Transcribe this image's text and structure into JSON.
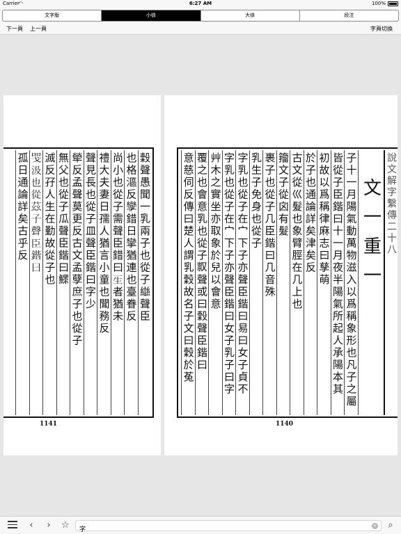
{
  "status": {
    "carrier": "Carrier",
    "wifi_icon": "wifi-icon",
    "time": "6:27 AM",
    "battery": "100%"
  },
  "segments": [
    {
      "label": "文字版",
      "active": false
    },
    {
      "label": "小徐",
      "active": true
    },
    {
      "label": "大徐",
      "active": false
    },
    {
      "label": "段注",
      "active": false
    }
  ],
  "nav": {
    "prev": "下一頁",
    "up": "上一頁",
    "switch": "字頁切換"
  },
  "pages": {
    "left": {
      "number": "1141",
      "columns": [
        "穀聲愚聞一乳兩子也從子䜌聲臣",
        "也格漚反孿錯日攣猶連也臺眷反",
        "尚小也從子需聲臣錯曰𤯔者猶未",
        "禮大夫妻日孺人猶言小童也聞務反",
        "聲見長也從子皿聲臣鍇曰字少",
        "犖反孟聲莫更反古文孟孽庶子也從子",
        "無父也從子瓜聲臣鍇曰鰥",
        "滅反孖人生在勤故從子也",
        "𢦸汲也從茲子聲臣鍇曰",
        "孤日通論詳矣古乎反"
      ]
    },
    "right": {
      "number": "1140",
      "columns": [
        "說文解字繫傳二十八",
        "文一重一",
        "子十一月陽氣動萬物滋入以爲稱象形也凡子之屬",
        "皆從子臣鍇曰十一月夜半陽氣所起人承陽本其",
        "初故以爲稱律麻志曰孳萌",
        "於子也通論詳矣津矣反",
        "古文從巛髮也象臂脛在几上也",
        "籀文子從囟有髮",
        "裹子也從子几臣鍇曰几音殊",
        "乳生子免身也從子",
        "字乳也從子在宀下子亦聲臣鍇曰易曰女子貞不",
        "字乳也從子在宀下子亦聲臣鍇曰女子乳子曰字",
        "艸木之實坐亦取象於兒以會意",
        "覆之也會意乳也從子𠭥聲或曰穀聲臣鍇曰",
        "意慈伺反傳曰楚人謂乳穀故名子文曰穀於菟"
      ]
    }
  },
  "search": {
    "value": "字",
    "placeholder": ""
  }
}
